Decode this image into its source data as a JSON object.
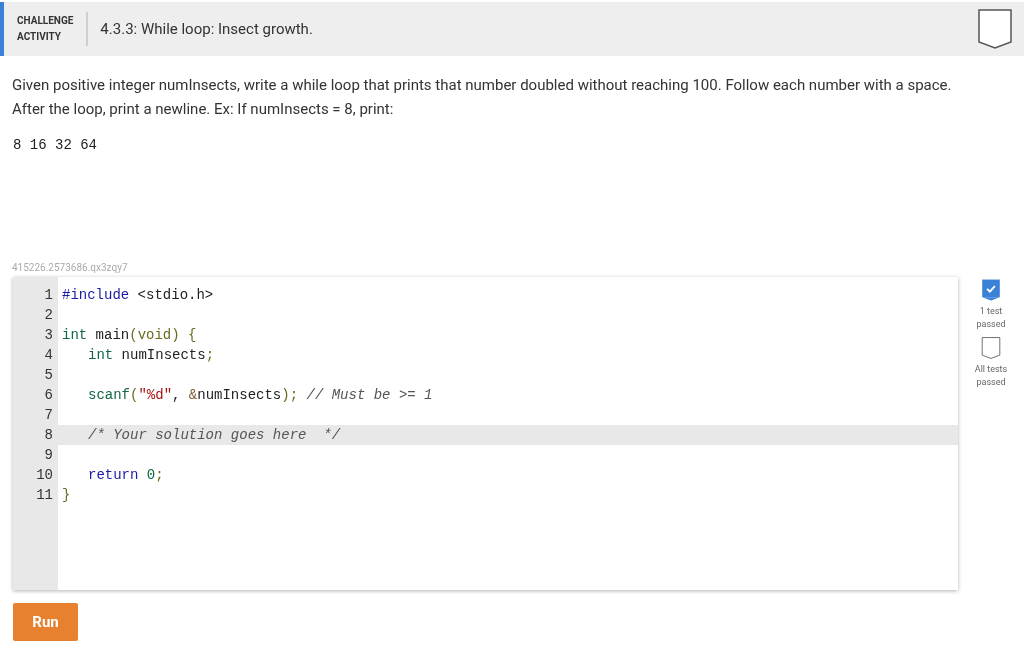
{
  "header": {
    "label": [
      "CHALLENGE",
      "ACTIVITY"
    ],
    "title": "4.3.3: While loop: Insect growth.",
    "completed": false
  },
  "prompt": "Given positive integer numInsects, write a while loop that prints that number doubled without reaching 100. Follow each number with a space. After the loop, print a newline. Ex: If numInsects = 8, print:",
  "example_output": "8 16 32 64",
  "activity_id": "415226.2573686.qx3zqy7",
  "code_lines": [
    {
      "number": "1",
      "active": false,
      "indented": false,
      "tokens": [
        {
          "kind": "keyword",
          "text": "#include"
        },
        {
          "kind": "plain",
          "text": " <stdio.h>"
        }
      ]
    },
    {
      "number": "2",
      "active": false
    },
    {
      "number": "3",
      "active": false,
      "indented": false,
      "tokens": [
        {
          "kind": "type",
          "text": "int"
        },
        {
          "kind": "plain",
          "text": " main"
        },
        {
          "kind": "bracket",
          "text": "(void) {"
        }
      ]
    },
    {
      "number": "4",
      "active": false,
      "indented": true,
      "tokens": [
        {
          "kind": "type",
          "text": "int"
        },
        {
          "kind": "plain",
          "text": " numInsects"
        },
        {
          "kind": "bracket",
          "text": ";"
        }
      ]
    },
    {
      "number": "5",
      "active": false
    },
    {
      "number": "6",
      "active": false,
      "indented": true,
      "tokens": [
        {
          "kind": "type",
          "text": "scanf"
        },
        {
          "kind": "bracket",
          "text": "("
        },
        {
          "kind": "string",
          "text": "\"%d\""
        },
        {
          "kind": "plain",
          "text": ", "
        },
        {
          "kind": "operator",
          "text": "&"
        },
        {
          "kind": "plain",
          "text": "numInsects"
        },
        {
          "kind": "bracket",
          "text": ");"
        },
        {
          "kind": "comment",
          "text": " // Must be >= 1"
        }
      ]
    },
    {
      "number": "7",
      "active": false
    },
    {
      "number": "8",
      "active": true,
      "indented": true,
      "tokens": [
        {
          "kind": "comment",
          "text": "/* Your solution goes here  */"
        }
      ]
    },
    {
      "number": "9",
      "active": false
    },
    {
      "number": "10",
      "active": false,
      "indented": true,
      "tokens": [
        {
          "kind": "keyword",
          "text": "return"
        },
        {
          "kind": "number",
          "text": " 0"
        },
        {
          "kind": "bracket",
          "text": ";"
        }
      ]
    },
    {
      "number": "11",
      "active": false,
      "indented": false,
      "tokens": [
        {
          "kind": "bracket",
          "text": "}"
        }
      ]
    }
  ],
  "tests": [
    {
      "label": "1 test passed",
      "completed": true
    },
    {
      "label": "All tests passed",
      "completed": false
    }
  ],
  "run_button": "Run"
}
